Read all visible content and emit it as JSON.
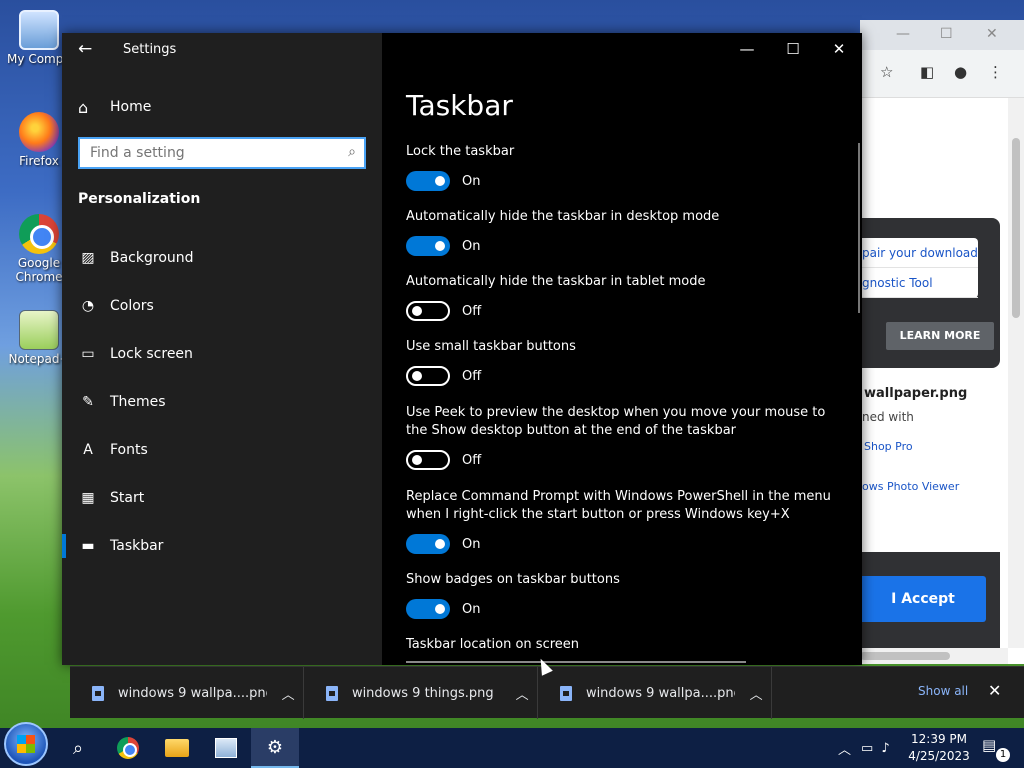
{
  "desktop": {
    "icons": [
      {
        "label": "My Compu",
        "icon": "computer-icon"
      },
      {
        "label": "Firefox",
        "icon": "firefox-icon"
      },
      {
        "label": "Google Chrome",
        "icon": "chrome-icon"
      },
      {
        "label": "Notepad+",
        "icon": "notepad-plus-icon"
      }
    ]
  },
  "browser": {
    "ad_links": [
      "pair your download",
      "gnostic Tool"
    ],
    "learn_more": "LEARN MORE",
    "file_title": "wallpaper.png",
    "opened_with": "ned with",
    "app_link_1": "Shop Pro",
    "app_link_2": "ows Photo Viewer",
    "accept": "I Accept"
  },
  "settings": {
    "app_title": "Settings",
    "home": "Home",
    "search_placeholder": "Find a setting",
    "section": "Personalization",
    "nav": [
      {
        "label": "Background",
        "icon": "image-icon"
      },
      {
        "label": "Colors",
        "icon": "palette-icon"
      },
      {
        "label": "Lock screen",
        "icon": "lock-screen-icon"
      },
      {
        "label": "Themes",
        "icon": "themes-icon"
      },
      {
        "label": "Fonts",
        "icon": "fonts-icon"
      },
      {
        "label": "Start",
        "icon": "start-icon"
      },
      {
        "label": "Taskbar",
        "icon": "taskbar-icon",
        "active": true
      }
    ],
    "page_title": "Taskbar",
    "options": [
      {
        "label": "Lock the taskbar",
        "state": "On"
      },
      {
        "label": "Automatically hide the taskbar in desktop mode",
        "state": "On"
      },
      {
        "label": "Automatically hide the taskbar in tablet mode",
        "state": "Off"
      },
      {
        "label": "Use small taskbar buttons",
        "state": "Off"
      },
      {
        "label": "Use Peek to preview the desktop when you move your mouse to the Show desktop button at the end of the taskbar",
        "state": "Off"
      },
      {
        "label": "Replace Command Prompt with Windows PowerShell in the menu when I right-click the start button or press Windows key+X",
        "state": "On"
      },
      {
        "label": "Show badges on taskbar buttons",
        "state": "On"
      }
    ],
    "location_label": "Taskbar location on screen"
  },
  "downloads": {
    "items": [
      {
        "name": "windows 9 wallpa....png"
      },
      {
        "name": "windows 9 things.png"
      },
      {
        "name": "windows 9 wallpa....png"
      }
    ],
    "show_all": "Show all"
  },
  "taskbar": {
    "time": "12:39 PM",
    "date": "4/25/2023",
    "notification_count": "1"
  },
  "colors": {
    "accent": "#0078d7",
    "taskbar": "#0d1f44"
  }
}
